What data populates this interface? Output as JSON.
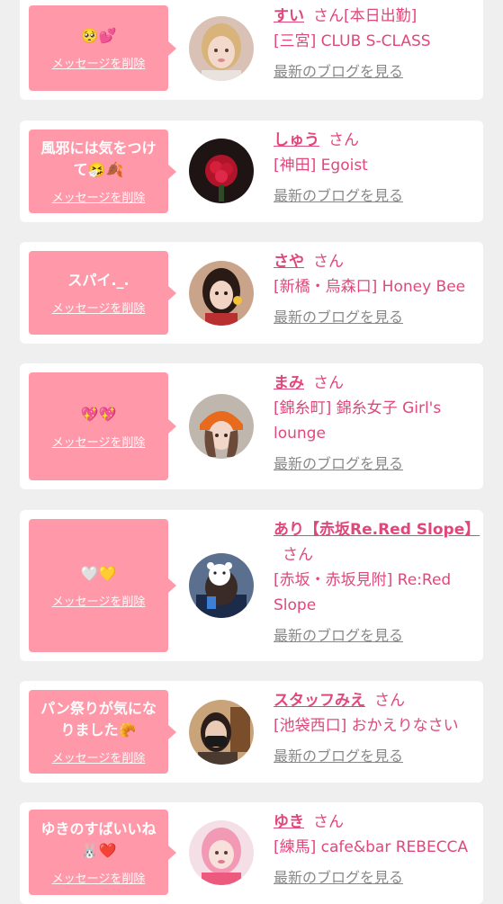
{
  "colors": {
    "page_bg": "#efefef",
    "card_bg": "#ffffff",
    "bubble_bg": "#ff99aa",
    "accent": "#e0487b",
    "link_gray": "#888888"
  },
  "labels": {
    "delete_message": "メッセージを削除",
    "latest_blog": "最新のブログを見る",
    "honorific": "さん"
  },
  "messages": [
    {
      "message": "🥺💕",
      "name": "すい",
      "name_suffix_inline": "[本日出勤]",
      "shop": "[三宮] CLUB S-CLASS",
      "avatar_icon": "avatar-photo-blonde-woman"
    },
    {
      "message": "風邪には気をつけて🤧🍂",
      "name": "しゅう",
      "name_suffix_inline": "",
      "shop": "[神田] Egoist",
      "avatar_icon": "avatar-photo-red-roses"
    },
    {
      "message": "スパイ._.",
      "name": "さや",
      "name_suffix_inline": "",
      "shop": "[新橋・烏森口] Honey Bee",
      "avatar_icon": "avatar-photo-dark-hair-woman"
    },
    {
      "message": "💖💖",
      "name": "まみ",
      "name_suffix_inline": "",
      "shop": "[錦糸町] 錦糸女子 Girl's lounge",
      "avatar_icon": "avatar-photo-orange-beanie"
    },
    {
      "message": "🤍💛",
      "name": "あり【赤坂Re.Red Slope】",
      "name_suffix_inline": "",
      "shop": "[赤坂・赤坂見附] Re:Red Slope",
      "avatar_icon": "avatar-photo-bear-sticker"
    },
    {
      "message": "パン祭りが気になりました🥐",
      "name": "スタッフみえ",
      "name_suffix_inline": "",
      "shop": "[池袋西口] おかえりなさい",
      "avatar_icon": "avatar-photo-masked-staff"
    },
    {
      "message": "ゆきのすばいいね🐰❤️",
      "name": "ゆき",
      "name_suffix_inline": "",
      "shop": "[練馬] cafe&bar REBECCA",
      "avatar_icon": "avatar-photo-pink-hair-woman"
    }
  ]
}
